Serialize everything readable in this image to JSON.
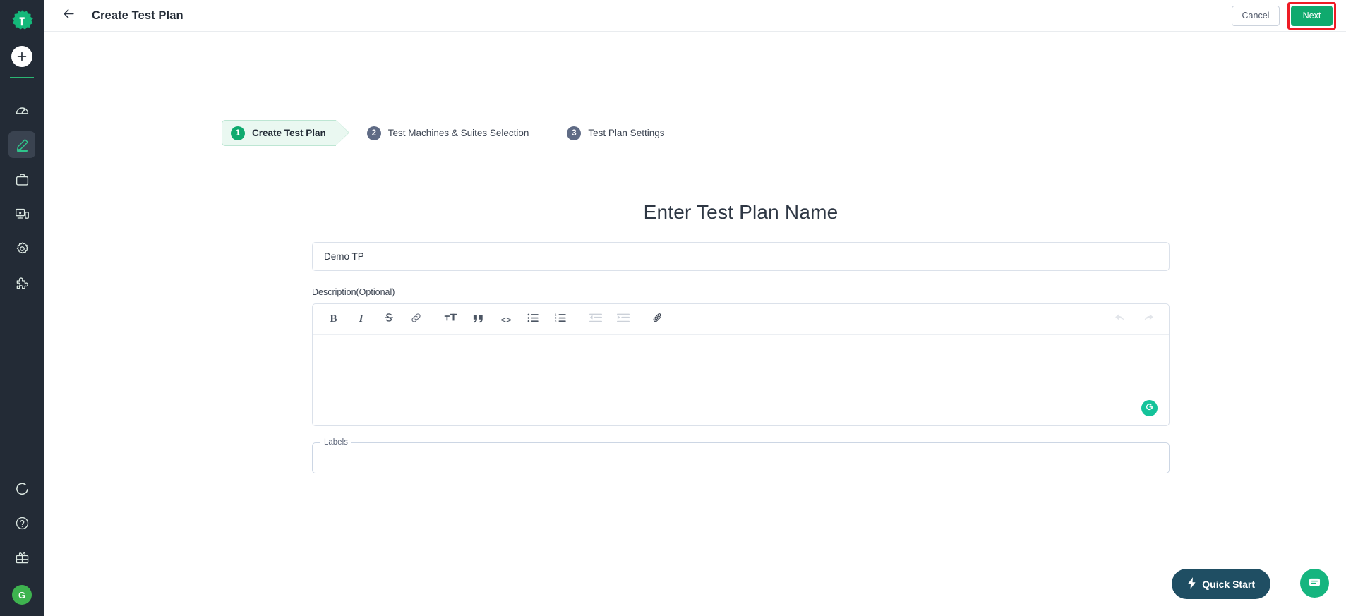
{
  "app": {
    "logo_icon": "testsigma-gear-logo",
    "accent_green": "#0faa6e",
    "sidebar_bg": "#232b36",
    "highlight_red": "#ee1c25"
  },
  "sidebar": {
    "add_button": {
      "name": "add-button",
      "icon": "plus-icon"
    },
    "items": [
      {
        "name": "sidebar-item-dashboard",
        "icon": "speedometer-icon",
        "active": false
      },
      {
        "name": "sidebar-item-create",
        "icon": "pencil-icon",
        "active": true
      },
      {
        "name": "sidebar-item-projects",
        "icon": "briefcase-icon",
        "active": false
      },
      {
        "name": "sidebar-item-devices",
        "icon": "devices-icon",
        "active": false
      },
      {
        "name": "sidebar-item-settings",
        "icon": "gear-icon",
        "active": false
      },
      {
        "name": "sidebar-item-addons",
        "icon": "puzzle-icon",
        "active": false
      }
    ],
    "bottom_items": [
      {
        "name": "sidebar-item-status",
        "icon": "loading-circle-icon"
      },
      {
        "name": "sidebar-item-help",
        "icon": "question-mark-icon"
      },
      {
        "name": "sidebar-item-whatsnew",
        "icon": "gift-icon"
      }
    ],
    "avatar_initial": "G"
  },
  "topbar": {
    "back_icon": "arrow-left-icon",
    "title": "Create Test Plan",
    "cancel_label": "Cancel",
    "next_label": "Next"
  },
  "stepper": {
    "steps": [
      {
        "number": "1",
        "label": "Create Test Plan",
        "active": true
      },
      {
        "number": "2",
        "label": "Test Machines & Suites Selection",
        "active": false
      },
      {
        "number": "3",
        "label": "Test Plan Settings",
        "active": false
      }
    ]
  },
  "form": {
    "heading": "Enter Test Plan Name",
    "name_value": "Demo TP",
    "name_placeholder": "Enter Test Plan Name",
    "description_label": "Description(Optional)",
    "description_value": "",
    "labels_legend": "Labels",
    "labels_value": "",
    "labels_placeholder": ""
  },
  "editor": {
    "toolbar": [
      {
        "name": "bold-button",
        "icon": "bold-icon",
        "glyph": "B",
        "disabled": false
      },
      {
        "name": "italic-button",
        "icon": "italic-icon",
        "glyph": "I",
        "disabled": false
      },
      {
        "name": "strikethrough-button",
        "icon": "strikethrough-icon",
        "glyph": "S",
        "disabled": false
      },
      {
        "name": "link-button",
        "icon": "link-icon",
        "glyph": "",
        "disabled": false
      },
      {
        "name": "text-size-button",
        "icon": "text-size-icon",
        "glyph": "TT",
        "disabled": false
      },
      {
        "name": "blockquote-button",
        "icon": "quote-icon",
        "glyph": "”",
        "disabled": false
      },
      {
        "name": "code-button",
        "icon": "code-brackets-icon",
        "glyph": "<>",
        "disabled": false
      },
      {
        "name": "bullet-list-button",
        "icon": "bullet-list-icon",
        "glyph": "",
        "disabled": false
      },
      {
        "name": "numbered-list-button",
        "icon": "numbered-list-icon",
        "glyph": "",
        "disabled": false
      },
      {
        "name": "outdent-button",
        "icon": "outdent-icon",
        "glyph": "",
        "disabled": true
      },
      {
        "name": "indent-button",
        "icon": "indent-icon",
        "glyph": "",
        "disabled": true
      },
      {
        "name": "attachment-button",
        "icon": "paperclip-icon",
        "glyph": "",
        "disabled": false
      }
    ],
    "undo": {
      "name": "undo-button",
      "icon": "undo-arrow-icon",
      "disabled": true
    },
    "redo": {
      "name": "redo-button",
      "icon": "redo-arrow-icon",
      "disabled": true
    },
    "grammarly_icon": "grammarly-g-icon"
  },
  "floating": {
    "quick_start_label": "Quick Start",
    "quick_start_icon": "lightning-bolt-icon",
    "chat_icon": "chat-bubble-icon"
  }
}
